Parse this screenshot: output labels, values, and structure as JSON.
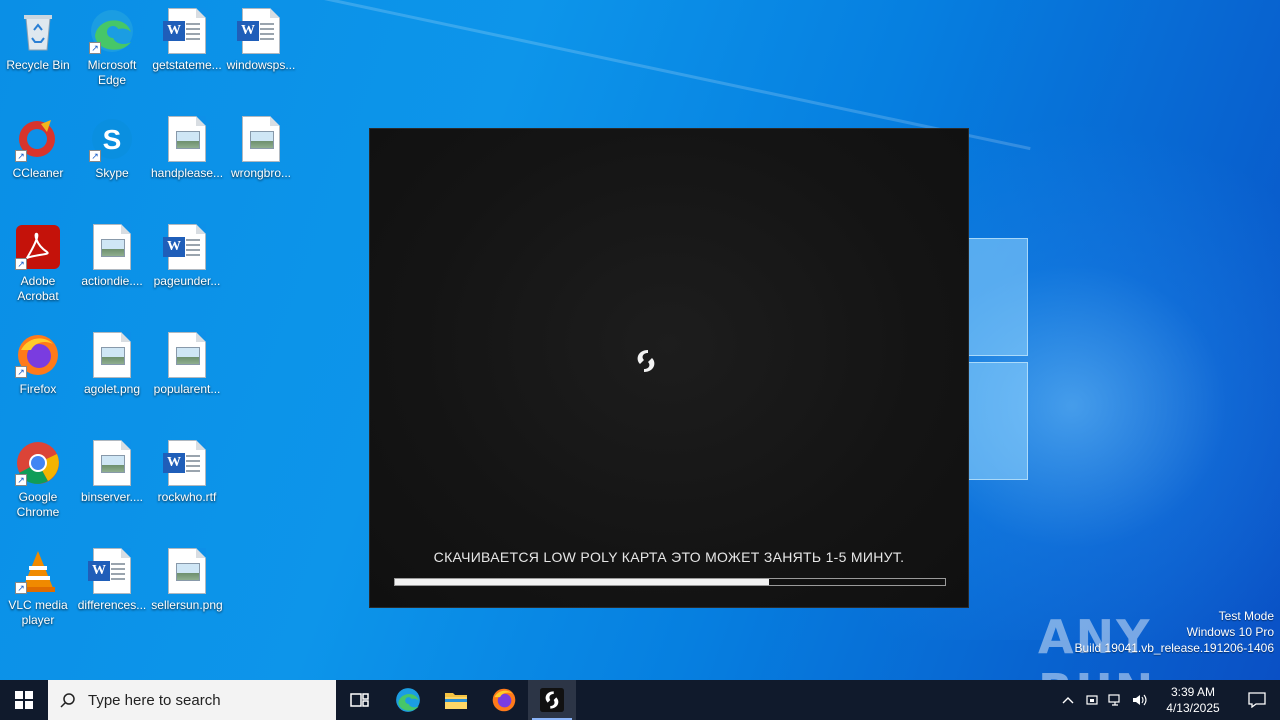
{
  "desktop": {
    "icons": [
      {
        "label": "Recycle Bin",
        "icon": "recycle-bin-icon"
      },
      {
        "label": "Microsoft Edge",
        "icon": "edge-icon"
      },
      {
        "label": "getstateme...",
        "icon": "word-doc-icon"
      },
      {
        "label": "windowsps...",
        "icon": "word-doc-icon"
      },
      {
        "label": "CCleaner",
        "icon": "ccleaner-icon"
      },
      {
        "label": "Skype",
        "icon": "skype-icon"
      },
      {
        "label": "handplease...",
        "icon": "image-file-icon"
      },
      {
        "label": "wrongbro...",
        "icon": "image-file-icon"
      },
      {
        "label": "Adobe Acrobat",
        "icon": "acrobat-icon"
      },
      {
        "label": "actiondie....",
        "icon": "image-file-icon"
      },
      {
        "label": "pageunder...",
        "icon": "word-doc-icon"
      },
      {
        "label": "Firefox",
        "icon": "firefox-icon"
      },
      {
        "label": "agolet.png",
        "icon": "image-file-icon"
      },
      {
        "label": "popularent...",
        "icon": "image-file-icon"
      },
      {
        "label": "Google Chrome",
        "icon": "chrome-icon"
      },
      {
        "label": "binserver....",
        "icon": "image-file-icon"
      },
      {
        "label": "rockwho.rtf",
        "icon": "word-doc-icon"
      },
      {
        "label": "VLC media player",
        "icon": "vlc-icon"
      },
      {
        "label": "differences...",
        "icon": "word-doc-icon"
      },
      {
        "label": "sellersun.png",
        "icon": "image-file-icon"
      }
    ]
  },
  "app": {
    "status_text": "СКАЧИВАЕТСЯ LOW POLY КАРТА ЭТО МОЖЕТ ЗАНЯТЬ 1-5 МИНУТ.",
    "progress_fraction": 0.68
  },
  "watermark": {
    "brand": "ANY RUN",
    "line1": "Test Mode",
    "line2": "Windows 10 Pro",
    "line3": "Build 19041.vb_release.191206-1406"
  },
  "taskbar": {
    "search_placeholder": "Type here to search",
    "clock_time": "3:39 AM",
    "clock_date": "4/13/2025"
  },
  "colors": {
    "taskbar": "#101a2c",
    "desktop_blue": "#0a8fe6",
    "app_bg": "#141414",
    "progress_fill": "#f2f2f2"
  }
}
